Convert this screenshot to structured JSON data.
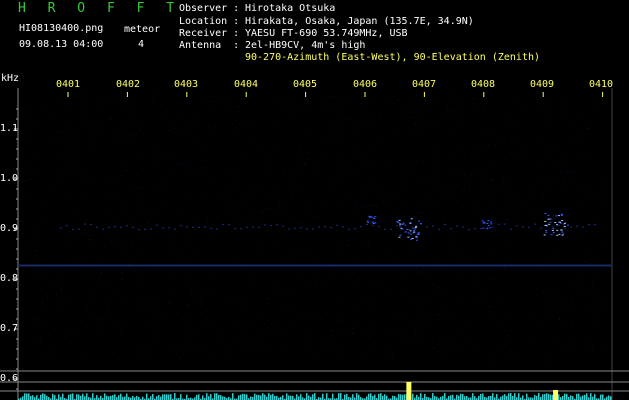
{
  "header": {
    "title": "H R O F F T",
    "filename": "HI08130400.png",
    "datetime": "09.08.13 04:00",
    "meteor_label": "meteor",
    "meteor_count": "4"
  },
  "info": [
    {
      "key": "Observer :",
      "value": "Hirotaka Otsuka"
    },
    {
      "key": "Location :",
      "value": "Hirakata, Osaka, Japan (135.7E, 34.9N)"
    },
    {
      "key": "Receiver :",
      "value": "YAESU FT-690 53.749MHz, USB"
    },
    {
      "key": "Antenna  :",
      "value": "2el-HB9CV, 4m's high"
    },
    {
      "key": "",
      "value": "90-270-Azimuth (East-West), 90-Elevation (Zenith)"
    }
  ],
  "axis": {
    "y_unit": "kHz",
    "y_ticks": [
      "1.1",
      "1.0",
      "0.9",
      "0.8",
      "0.7",
      "0.6"
    ],
    "x_ticks": [
      "0401",
      "0402",
      "0403",
      "0404",
      "0405",
      "0406",
      "0407",
      "0408",
      "0409",
      "0410"
    ]
  },
  "colors": {
    "background": "#000000",
    "text": "#ffffff",
    "title": "#33cc33",
    "time_labels": "#ffff66",
    "grid": "#333333",
    "echo": "#3355ff",
    "echo_strong": "#aaccff",
    "baseline": "#888888",
    "signal_bars": "#33cccc",
    "signal_peak": "#ffff66"
  },
  "echoes": [
    {
      "minute": 6.73,
      "freq": 0.9,
      "strength": "strong"
    },
    {
      "minute": 9.2,
      "freq": 0.91,
      "strength": "strong"
    },
    {
      "minute": 8.05,
      "freq": 0.91,
      "strength": "weak"
    },
    {
      "minute": 6.1,
      "freq": 0.92,
      "strength": "weak"
    }
  ]
}
